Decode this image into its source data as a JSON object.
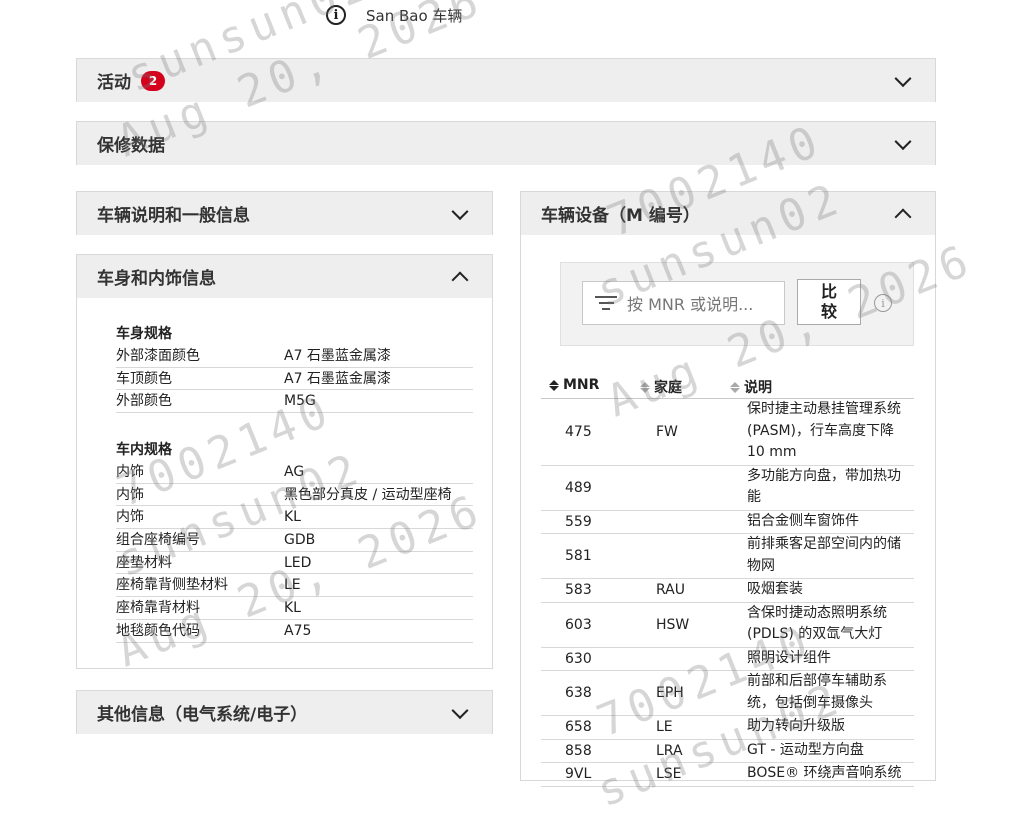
{
  "header": {
    "vehicle_label": "San Bao 车辆"
  },
  "sections": {
    "activity": {
      "title": "活动",
      "badge": "2"
    },
    "warranty": {
      "title": "保修数据"
    },
    "general": {
      "title": "车辆说明和一般信息"
    },
    "body_trim": {
      "title": "车身和内饰信息",
      "body_spec": {
        "title": "车身规格",
        "rows": [
          {
            "k": "外部漆面颜色",
            "v": "A7 石墨蓝金属漆"
          },
          {
            "k": "车顶颜色",
            "v": "A7 石墨蓝金属漆"
          },
          {
            "k": "外部颜色",
            "v": "M5G"
          }
        ]
      },
      "interior_spec": {
        "title": "车内规格",
        "rows": [
          {
            "k": "内饰",
            "v": "AG"
          },
          {
            "k": "内饰",
            "v": "黑色部分真皮 / 运动型座椅"
          },
          {
            "k": "内饰",
            "v": "KL"
          },
          {
            "k": "组合座椅编号",
            "v": "GDB"
          },
          {
            "k": "座垫材料",
            "v": "LED"
          },
          {
            "k": "座椅靠背侧垫材料",
            "v": "LE"
          },
          {
            "k": "座椅靠背材料",
            "v": "KL"
          },
          {
            "k": "地毯颜色代码",
            "v": "A75"
          }
        ]
      }
    },
    "other": {
      "title": "其他信息（电气系统/电子）"
    },
    "equipment": {
      "title": "车辆设备（M 编号）",
      "search_placeholder": "按 MNR 或说明...",
      "compare_label": "比较",
      "columns": {
        "mnr": "MNR",
        "family": "家庭",
        "desc": "说明"
      },
      "rows": [
        {
          "mnr": "475",
          "fam": "FW",
          "desc": "保时捷主动悬挂管理系统 (PASM)，行车高度下降 10 mm"
        },
        {
          "mnr": "489",
          "fam": "",
          "desc": "多功能方向盘，带加热功能"
        },
        {
          "mnr": "559",
          "fam": "",
          "desc": "铝合金侧车窗饰件"
        },
        {
          "mnr": "581",
          "fam": "",
          "desc": "前排乘客足部空间内的储物网"
        },
        {
          "mnr": "583",
          "fam": "RAU",
          "desc": "吸烟套装"
        },
        {
          "mnr": "603",
          "fam": "HSW",
          "desc": "含保时捷动态照明系统 (PDLS) 的双氙气大灯"
        },
        {
          "mnr": "630",
          "fam": "",
          "desc": "照明设计组件"
        },
        {
          "mnr": "638",
          "fam": "EPH",
          "desc": "前部和后部停车辅助系统，包括倒车摄像头"
        },
        {
          "mnr": "658",
          "fam": "LE",
          "desc": "助力转向升级版"
        },
        {
          "mnr": "858",
          "fam": "LRA",
          "desc": "GT - 运动型方向盘"
        },
        {
          "mnr": "9VL",
          "fam": "LSE",
          "desc": "BOSE® 环绕声音响系统"
        }
      ]
    }
  },
  "watermark": {
    "user": "sunsun02",
    "date": "Aug 20, 2026",
    "id": "7002140"
  }
}
